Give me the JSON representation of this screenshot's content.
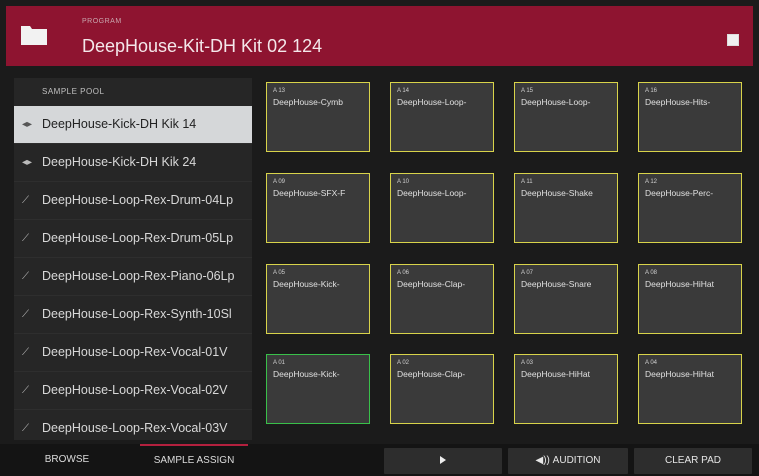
{
  "header": {
    "kit_label": "PROGRAM",
    "kit_name": "DeepHouse-Kit-DH Kit 02 124"
  },
  "sample_pool": {
    "title": "SAMPLE POOL",
    "items": [
      {
        "icon": "audio-icon",
        "label": "DeepHouse-Kick-DH Kik 14",
        "selected": true
      },
      {
        "icon": "audio-icon",
        "label": "DeepHouse-Kick-DH Kik 24"
      },
      {
        "icon": "pencil-icon",
        "label": "DeepHouse-Loop-Rex-Drum-04Lp"
      },
      {
        "icon": "pencil-icon",
        "label": "DeepHouse-Loop-Rex-Drum-05Lp"
      },
      {
        "icon": "pencil-icon",
        "label": "DeepHouse-Loop-Rex-Piano-06Lp"
      },
      {
        "icon": "pencil-icon",
        "label": "DeepHouse-Loop-Rex-Synth-10Sl"
      },
      {
        "icon": "pencil-icon",
        "label": "DeepHouse-Loop-Rex-Vocal-01V"
      },
      {
        "icon": "pencil-icon",
        "label": "DeepHouse-Loop-Rex-Vocal-02V"
      },
      {
        "icon": "pencil-icon",
        "label": "DeepHouse-Loop-Rex-Vocal-03V"
      }
    ]
  },
  "pads": [
    {
      "num": "A 13",
      "label": "DeepHouse-Cymb"
    },
    {
      "num": "A 14",
      "label": "DeepHouse-Loop-"
    },
    {
      "num": "A 15",
      "label": "DeepHouse-Loop-"
    },
    {
      "num": "A 16",
      "label": "DeepHouse-Hits-"
    },
    {
      "num": "A 09",
      "label": "DeepHouse-SFX-F"
    },
    {
      "num": "A 10",
      "label": "DeepHouse-Loop-"
    },
    {
      "num": "A 11",
      "label": "DeepHouse-Shake"
    },
    {
      "num": "A 12",
      "label": "DeepHouse-Perc-"
    },
    {
      "num": "A 05",
      "label": "DeepHouse-Kick-"
    },
    {
      "num": "A 06",
      "label": "DeepHouse-Clap-"
    },
    {
      "num": "A 07",
      "label": "DeepHouse-Snare"
    },
    {
      "num": "A 08",
      "label": "DeepHouse-HiHat"
    },
    {
      "num": "A 01",
      "label": "DeepHouse-Kick-",
      "active": true
    },
    {
      "num": "A 02",
      "label": "DeepHouse-Clap-"
    },
    {
      "num": "A 03",
      "label": "DeepHouse-HiHat"
    },
    {
      "num": "A 04",
      "label": "DeepHouse-HiHat"
    }
  ],
  "bottom": {
    "browse": "BROWSE",
    "sample_assign": "SAMPLE ASSIGN",
    "audition": "AUDITION",
    "clear_pad": "CLEAR PAD"
  },
  "colors": {
    "header": "#8e1430",
    "pad_border": "#d8d34a",
    "active_pad_border": "#39c04a"
  }
}
